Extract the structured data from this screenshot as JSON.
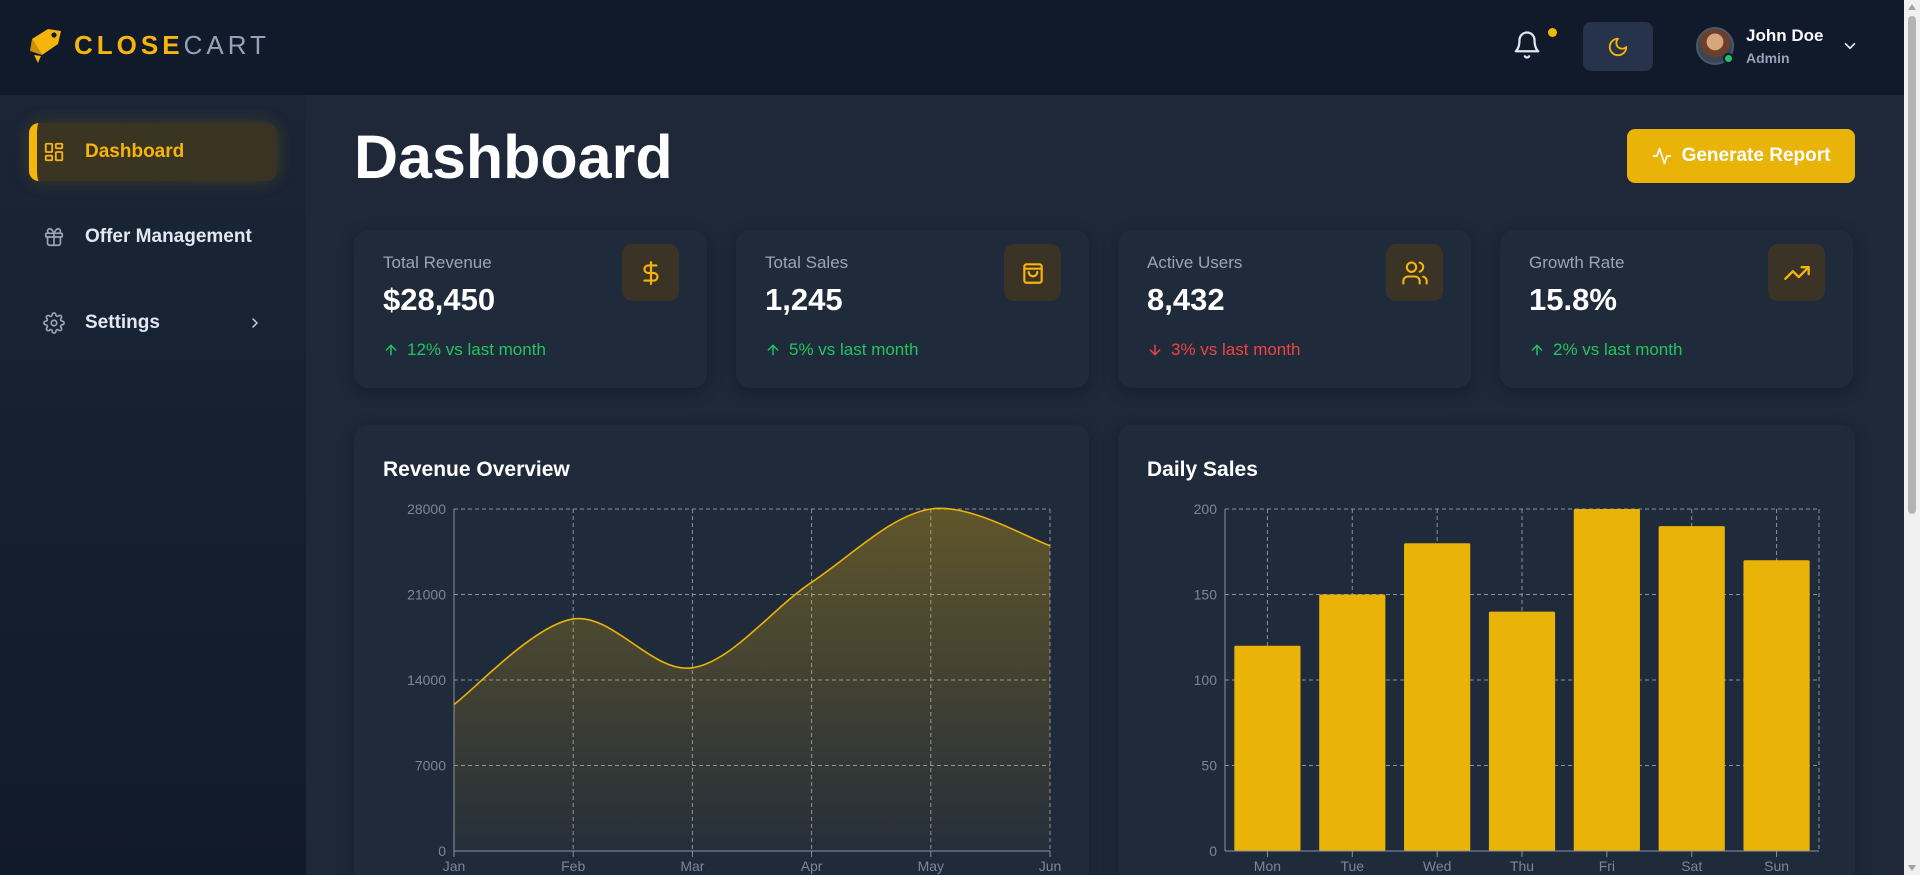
{
  "brand": {
    "part1": "CLOSE",
    "part2": "CART"
  },
  "header": {
    "user_name": "John Doe",
    "user_role": "Admin",
    "icons": [
      "bell-icon",
      "moon-icon",
      "chevron-down-icon"
    ]
  },
  "sidebar": {
    "items": [
      {
        "label": "Dashboard",
        "icon": "dashboard-grid-icon",
        "active": true
      },
      {
        "label": "Offer Management",
        "icon": "gift-icon",
        "active": false
      },
      {
        "label": "Settings",
        "icon": "gear-icon",
        "active": false
      }
    ]
  },
  "page": {
    "title": "Dashboard",
    "report_button": "Generate Report"
  },
  "stats": [
    {
      "label": "Total Revenue",
      "value": "$28,450",
      "trend": "12% vs last month",
      "direction": "up",
      "icon": "dollar-icon"
    },
    {
      "label": "Total Sales",
      "value": "1,245",
      "trend": "5% vs last month",
      "direction": "up",
      "icon": "shopping-bag-icon"
    },
    {
      "label": "Active Users",
      "value": "8,432",
      "trend": "3% vs last month",
      "direction": "down",
      "icon": "users-icon"
    },
    {
      "label": "Growth Rate",
      "value": "15.8%",
      "trend": "2% vs last month",
      "direction": "up",
      "icon": "trending-up-icon"
    }
  ],
  "colors": {
    "accent": "#eab308",
    "up": "#22c55e",
    "down": "#ef4444",
    "background": "#1e2838",
    "card": "#1f2a3b"
  },
  "chart_data": [
    {
      "type": "area",
      "title": "Revenue Overview",
      "x": [
        "Jan",
        "Feb",
        "Mar",
        "Apr",
        "May",
        "Jun"
      ],
      "values": [
        12000,
        19000,
        15000,
        22000,
        28000,
        25000
      ],
      "yticks": [
        0,
        7000,
        14000,
        21000,
        28000
      ],
      "ylim": [
        0,
        28000
      ],
      "grid": true
    },
    {
      "type": "bar",
      "title": "Daily Sales",
      "categories": [
        "Mon",
        "Tue",
        "Wed",
        "Thu",
        "Fri",
        "Sat",
        "Sun"
      ],
      "values": [
        120,
        150,
        180,
        140,
        200,
        190,
        170
      ],
      "yticks": [
        0,
        50,
        100,
        150,
        200
      ],
      "ylim": [
        0,
        200
      ],
      "grid": true
    }
  ]
}
